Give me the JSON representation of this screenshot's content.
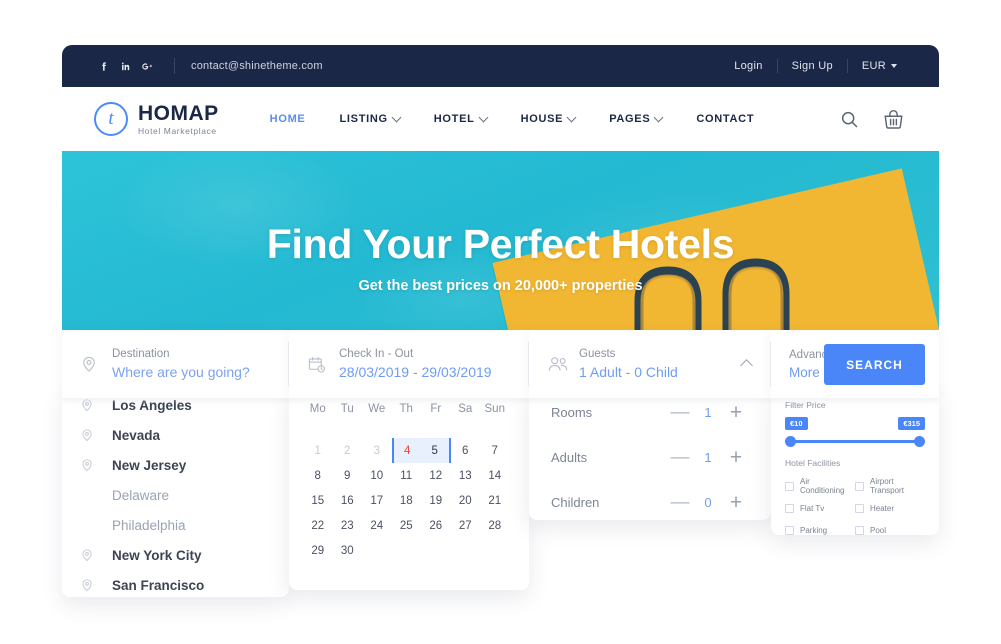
{
  "topbar": {
    "socials": [
      {
        "name": "facebook-icon",
        "glyph": "f"
      },
      {
        "name": "linkedin-icon",
        "glyph": "in"
      },
      {
        "name": "googleplus-icon",
        "glyph": "G+"
      }
    ],
    "email": "contact@shinetheme.com",
    "login": "Login",
    "signup": "Sign Up",
    "currency": "EUR"
  },
  "header": {
    "logo_letter": "t",
    "logo_title": "HOMAP",
    "logo_subtitle": "Hotel Marketplace",
    "nav": [
      {
        "label": "HOME",
        "active": true,
        "dropdown": false
      },
      {
        "label": "LISTING",
        "active": false,
        "dropdown": true
      },
      {
        "label": "HOTEL",
        "active": false,
        "dropdown": true
      },
      {
        "label": "HOUSE",
        "active": false,
        "dropdown": true
      },
      {
        "label": "PAGES",
        "active": false,
        "dropdown": true
      },
      {
        "label": "CONTACT",
        "active": false,
        "dropdown": false
      }
    ],
    "search_icon": "search-icon",
    "cart_icon": "basket-icon"
  },
  "hero": {
    "title": "Find Your Perfect Hotels",
    "subtitle": "Get the best prices on 20,000+ properties"
  },
  "search": {
    "destination": {
      "label": "Destination",
      "placeholder": "Where are you going?",
      "value": ""
    },
    "dates": {
      "label": "Check In - Out",
      "value": "28/03/2019 - 29/03/2019"
    },
    "guests": {
      "label": "Guests",
      "value": "1 Adult - 0 Child"
    },
    "advance": {
      "label": "Advance",
      "more": "More"
    },
    "search_button": "SEARCH"
  },
  "destination_list": [
    {
      "name": "Los Angeles",
      "has_pin": true,
      "muted": false
    },
    {
      "name": "Nevada",
      "has_pin": true,
      "muted": false
    },
    {
      "name": "New Jersey",
      "has_pin": true,
      "muted": false
    },
    {
      "name": "Delaware",
      "has_pin": false,
      "muted": true
    },
    {
      "name": "Philadelphia",
      "has_pin": false,
      "muted": true
    },
    {
      "name": "New York City",
      "has_pin": true,
      "muted": false
    },
    {
      "name": "San Francisco",
      "has_pin": true,
      "muted": false
    }
  ],
  "calendar": {
    "weekdays": [
      "Mo",
      "Tu",
      "We",
      "Th",
      "Fr",
      "Sa",
      "Sun"
    ],
    "weeks": [
      [
        {
          "d": "1",
          "state": "dim"
        },
        {
          "d": "2",
          "state": "dim"
        },
        {
          "d": "3",
          "state": "dim"
        },
        {
          "d": "4",
          "state": "sel-start"
        },
        {
          "d": "5",
          "state": "sel-end"
        },
        {
          "d": "6",
          "state": "normal"
        },
        {
          "d": "7",
          "state": "normal"
        }
      ],
      [
        {
          "d": "8",
          "state": "normal"
        },
        {
          "d": "9",
          "state": "normal"
        },
        {
          "d": "10",
          "state": "normal"
        },
        {
          "d": "11",
          "state": "normal"
        },
        {
          "d": "12",
          "state": "normal"
        },
        {
          "d": "13",
          "state": "normal"
        },
        {
          "d": "14",
          "state": "normal"
        }
      ],
      [
        {
          "d": "15",
          "state": "normal"
        },
        {
          "d": "16",
          "state": "normal"
        },
        {
          "d": "17",
          "state": "normal"
        },
        {
          "d": "18",
          "state": "normal"
        },
        {
          "d": "19",
          "state": "normal"
        },
        {
          "d": "20",
          "state": "normal"
        },
        {
          "d": "21",
          "state": "normal"
        }
      ],
      [
        {
          "d": "22",
          "state": "normal"
        },
        {
          "d": "23",
          "state": "normal"
        },
        {
          "d": "24",
          "state": "normal"
        },
        {
          "d": "25",
          "state": "normal"
        },
        {
          "d": "26",
          "state": "normal"
        },
        {
          "d": "27",
          "state": "normal"
        },
        {
          "d": "28",
          "state": "normal"
        }
      ],
      [
        {
          "d": "29",
          "state": "normal"
        },
        {
          "d": "30",
          "state": "normal"
        },
        {
          "d": "",
          "state": "empty"
        },
        {
          "d": "",
          "state": "empty"
        },
        {
          "d": "",
          "state": "empty"
        },
        {
          "d": "",
          "state": "empty"
        },
        {
          "d": "",
          "state": "empty"
        }
      ]
    ]
  },
  "guests_panel": {
    "rows": [
      {
        "label": "Rooms",
        "count": "1"
      },
      {
        "label": "Adults",
        "count": "1"
      },
      {
        "label": "Children",
        "count": "0"
      }
    ],
    "minus": "—",
    "plus": "+"
  },
  "advance_panel": {
    "filter_price_title": "Filter Price",
    "price_min": "€10",
    "price_max": "€315",
    "facilities_title": "Hotel Facilities",
    "facilities": [
      {
        "label": "Air Conditioning",
        "checked": false
      },
      {
        "label": "Airport Transport",
        "checked": false
      },
      {
        "label": "Flat Tv",
        "checked": false
      },
      {
        "label": "Heater",
        "checked": false
      },
      {
        "label": "Parking",
        "checked": false
      },
      {
        "label": "Pool",
        "checked": false
      }
    ]
  },
  "colors": {
    "navy": "#1b2746",
    "accent_blue": "#4a86f7",
    "hero_water": "#27bcd4",
    "sand": "#f2b732",
    "red": "#ef4136"
  }
}
